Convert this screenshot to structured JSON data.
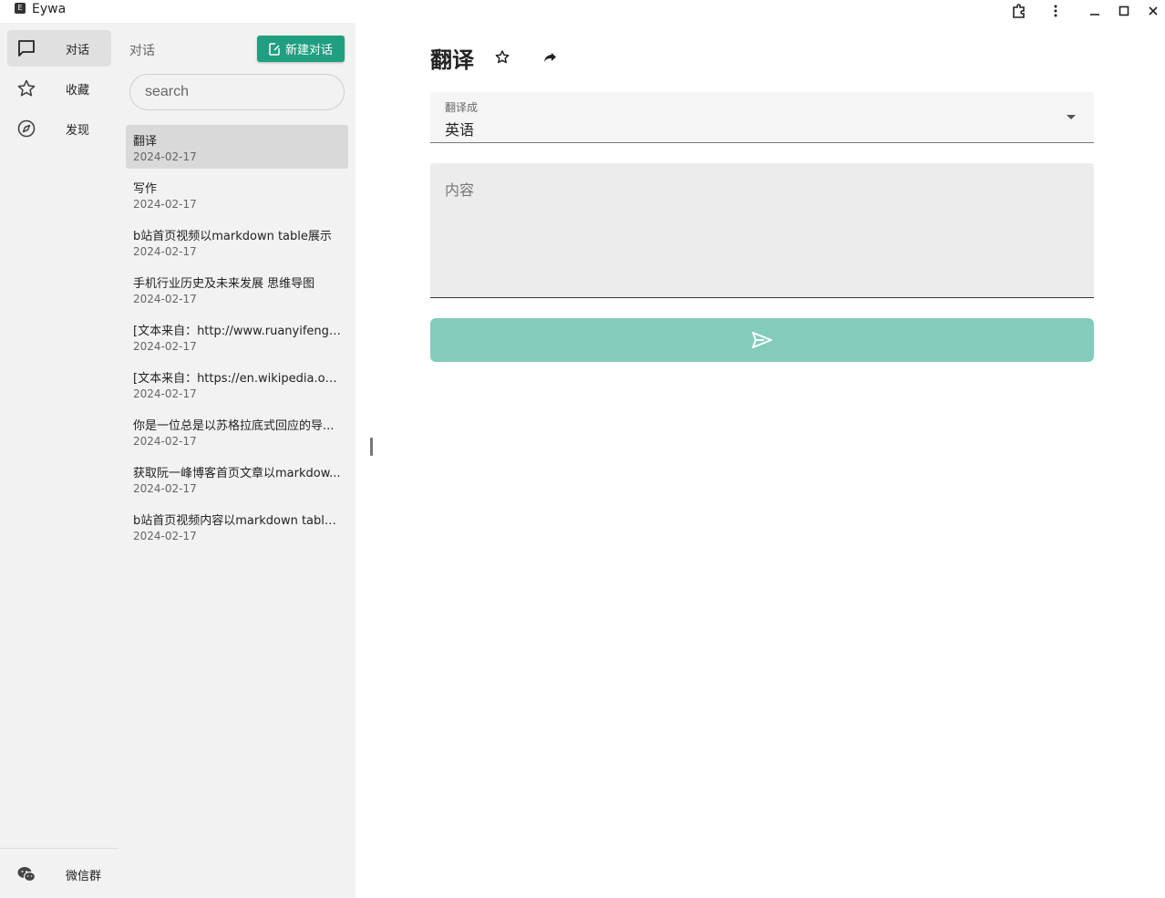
{
  "titlebar": {
    "app_icon_letter": "E",
    "title": "Eywa"
  },
  "rail": {
    "items": [
      {
        "label": "对话",
        "icon": "chat-bubble-icon"
      },
      {
        "label": "收藏",
        "icon": "star-icon"
      },
      {
        "label": "发现",
        "icon": "compass-icon"
      }
    ],
    "footer": {
      "label": "微信群",
      "icon": "wechat-icon"
    }
  },
  "panel": {
    "title": "对话",
    "new_button_label": "新建对话",
    "search_placeholder": "search",
    "conversations": [
      {
        "title": "翻译",
        "date": "2024-02-17"
      },
      {
        "title": "写作",
        "date": "2024-02-17"
      },
      {
        "title": "b站首页视频以markdown table展示",
        "date": "2024-02-17"
      },
      {
        "title": "手机行业历史及未来发展 思维导图",
        "date": "2024-02-17"
      },
      {
        "title": "[文本来自：http://www.ruanyifeng.co...",
        "date": "2024-02-17"
      },
      {
        "title": "[文本来自：https://en.wikipedia.org/...",
        "date": "2024-02-17"
      },
      {
        "title": "你是一位总是以苏格拉底式回应的导...",
        "date": "2024-02-17"
      },
      {
        "title": "获取阮一峰博客首页文章以markdow...",
        "date": "2024-02-17"
      },
      {
        "title": "b站首页视频内容以markdown table ...",
        "date": "2024-02-17"
      }
    ]
  },
  "main": {
    "title": "翻译",
    "select": {
      "label": "翻译成",
      "value": "英语"
    },
    "content_placeholder": "内容"
  },
  "colors": {
    "accent": "#1f9f80",
    "send_button": "#83ccbc",
    "sidebar_bg": "#f2f2f2"
  }
}
